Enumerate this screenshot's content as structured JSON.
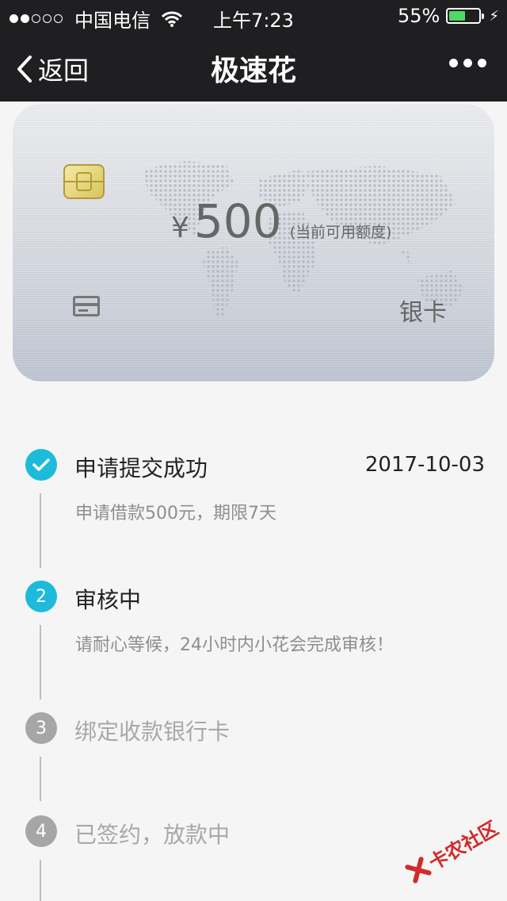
{
  "status_bar": {
    "signal_dots": [
      "on",
      "on",
      "off",
      "off",
      "off"
    ],
    "carrier": "中国电信",
    "time": "上午7:23",
    "battery_percent": "55%",
    "battery_level": 0.55
  },
  "nav": {
    "back_label": "返回",
    "title": "极速花"
  },
  "card": {
    "currency_symbol": "¥",
    "amount": "500",
    "amount_note": "(当前可用额度)",
    "card_type": "银卡"
  },
  "steps": [
    {
      "index": "",
      "title": "申请提交成功",
      "date": "2017-10-03",
      "description": "申请借款500元，期限7天",
      "state": "done"
    },
    {
      "index": "2",
      "title": "审核中",
      "date": "",
      "description": "请耐心等候，24小时内小花会完成审核！",
      "state": "active"
    },
    {
      "index": "3",
      "title": "绑定收款银行卡",
      "date": "",
      "description": "",
      "state": "pending"
    },
    {
      "index": "4",
      "title": "已签约，放款中",
      "date": "",
      "description": "",
      "state": "pending"
    }
  ],
  "watermark": {
    "text": "卡农社区"
  },
  "colors": {
    "accent": "#1dbbd9",
    "pending": "#a6a6a6",
    "nav_bg": "#1f1f21"
  }
}
